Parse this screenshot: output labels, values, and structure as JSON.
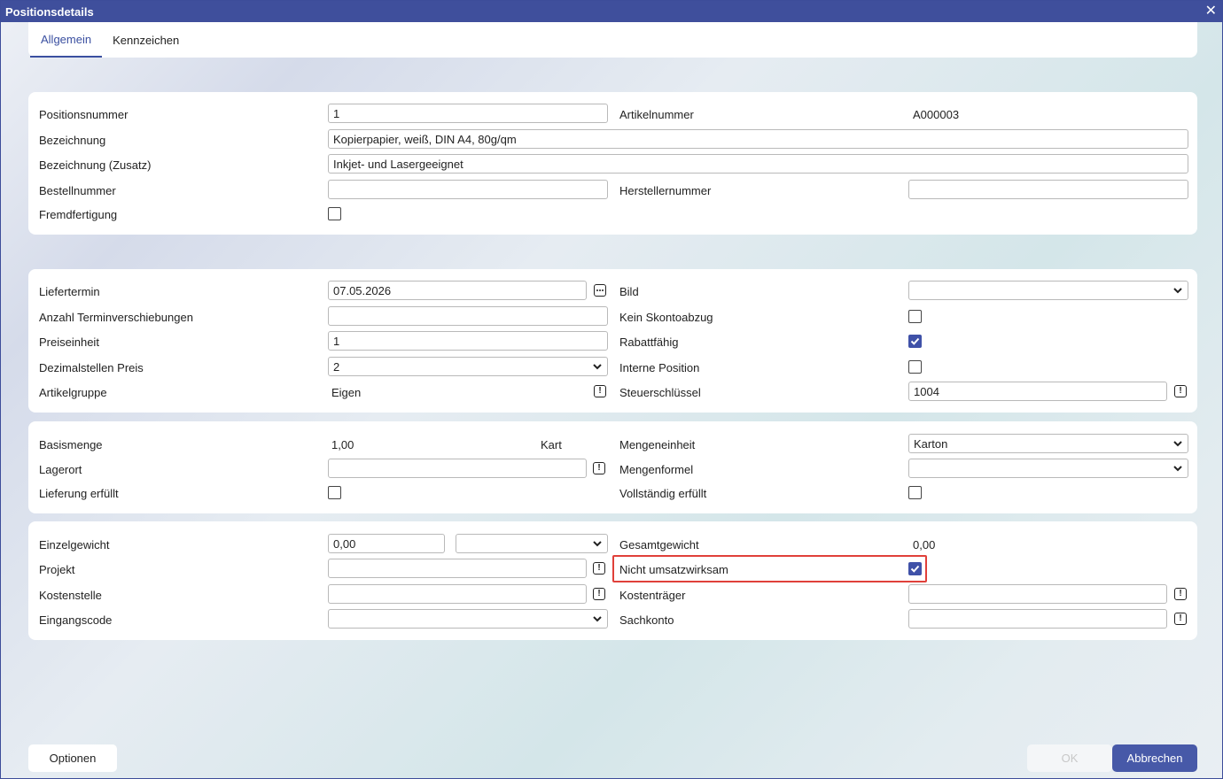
{
  "window": {
    "title": "Positionsdetails"
  },
  "tabs": [
    {
      "label": "Allgemein"
    },
    {
      "label": "Kennzeichen"
    }
  ],
  "section1": {
    "positionsnummer": {
      "label": "Positionsnummer",
      "value": "1"
    },
    "artikelnummer": {
      "label": "Artikelnummer",
      "value": "A000003"
    },
    "bezeichnung": {
      "label": "Bezeichnung",
      "value": "Kopierpapier, weiß, DIN A4, 80g/qm"
    },
    "bezeichnung_zusatz": {
      "label": "Bezeichnung (Zusatz)",
      "value": "Inkjet- und Lasergeeignet"
    },
    "bestellnummer": {
      "label": "Bestellnummer",
      "value": ""
    },
    "herstellernummer": {
      "label": "Herstellernummer",
      "value": ""
    },
    "fremdfertigung": {
      "label": "Fremdfertigung",
      "checked": false
    }
  },
  "section2": {
    "liefertermin": {
      "label": "Liefertermin",
      "value": "07.05.2026"
    },
    "bild": {
      "label": "Bild",
      "value": ""
    },
    "anzahl_terminverschiebungen": {
      "label": "Anzahl Terminverschiebungen",
      "value": ""
    },
    "kein_skontoabzug": {
      "label": "Kein Skontoabzug",
      "checked": false
    },
    "preiseinheit": {
      "label": "Preiseinheit",
      "value": "1"
    },
    "rabattfaehig": {
      "label": "Rabattfähig",
      "checked": true
    },
    "dezimalstellen_preis": {
      "label": "Dezimalstellen Preis",
      "value": "2"
    },
    "interne_position": {
      "label": "Interne Position",
      "checked": false
    },
    "artikelgruppe": {
      "label": "Artikelgruppe",
      "value": "Eigen"
    },
    "steuerschluessel": {
      "label": "Steuerschlüssel",
      "value": "1004"
    }
  },
  "section3": {
    "basismenge": {
      "label": "Basismenge",
      "value": "1,00",
      "unit": "Kart"
    },
    "mengeneinheit": {
      "label": "Mengeneinheit",
      "value": "Karton"
    },
    "lagerort": {
      "label": "Lagerort",
      "value": ""
    },
    "mengenformel": {
      "label": "Mengenformel",
      "value": ""
    },
    "lieferung_erfuellt": {
      "label": "Lieferung erfüllt",
      "checked": false
    },
    "vollstaendig_erfuellt": {
      "label": "Vollständig erfüllt",
      "checked": false
    }
  },
  "section4": {
    "einzelgewicht": {
      "label": "Einzelgewicht",
      "value": "0,00",
      "unit": ""
    },
    "gesamtgewicht": {
      "label": "Gesamtgewicht",
      "value": "0,00"
    },
    "projekt": {
      "label": "Projekt",
      "value": ""
    },
    "nicht_umsatzwirksam": {
      "label": "Nicht umsatzwirksam",
      "checked": true
    },
    "kostenstelle": {
      "label": "Kostenstelle",
      "value": ""
    },
    "kostentraeger": {
      "label": "Kostenträger",
      "value": ""
    },
    "eingangscode": {
      "label": "Eingangscode",
      "value": ""
    },
    "sachkonto": {
      "label": "Sachkonto",
      "value": ""
    }
  },
  "footer": {
    "options_label": "Optionen",
    "ok_label": "OK",
    "cancel_label": "Abbrechen"
  },
  "colors": {
    "accent": "#3f51a8",
    "titlebar": "#3f4f9c",
    "highlight": "#e0403a"
  }
}
